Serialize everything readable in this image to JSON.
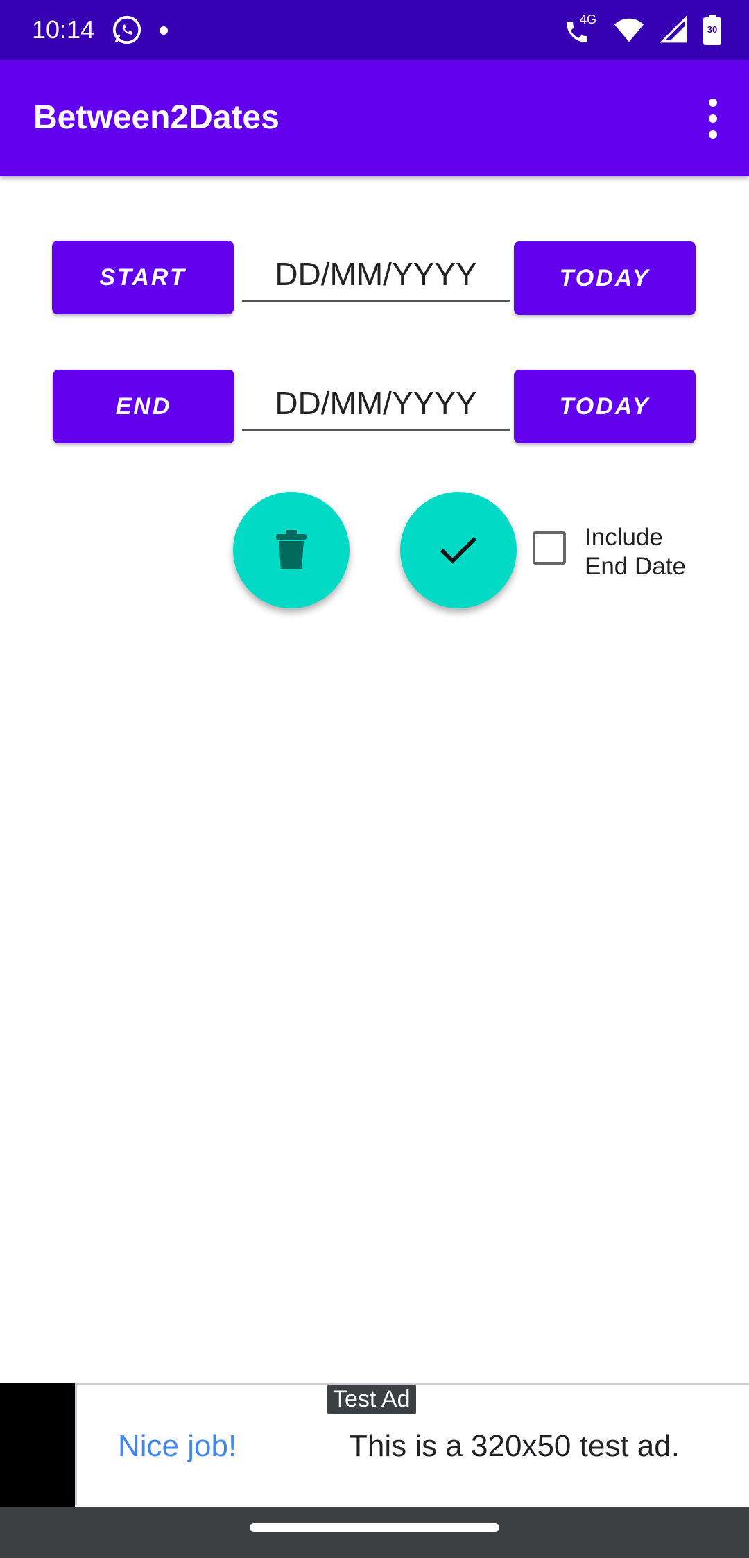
{
  "status_bar": {
    "time": "10:14",
    "network": "4G",
    "battery": "30"
  },
  "app_bar": {
    "title": "Between2Dates"
  },
  "form": {
    "start_button": "START",
    "start_placeholder": "DD/MM/YYYY",
    "start_today_button": "TODAY",
    "end_button": "END",
    "end_placeholder": "DD/MM/YYYY",
    "end_today_button": "TODAY",
    "include_end_date_line1": "Include",
    "include_end_date_line2": "End Date",
    "include_end_date_checked": false
  },
  "ad": {
    "tag": "Test Ad",
    "headline": "Nice job!",
    "text": "This is a 320x50 test ad."
  },
  "colors": {
    "status_bar": "#3700b3",
    "primary": "#6200ee",
    "accent": "#03dac5"
  },
  "icons": [
    "whatsapp-icon",
    "wifi-call-icon",
    "wifi-icon",
    "signal-icon",
    "battery-icon",
    "more-vert-icon",
    "delete-icon",
    "check-icon"
  ]
}
